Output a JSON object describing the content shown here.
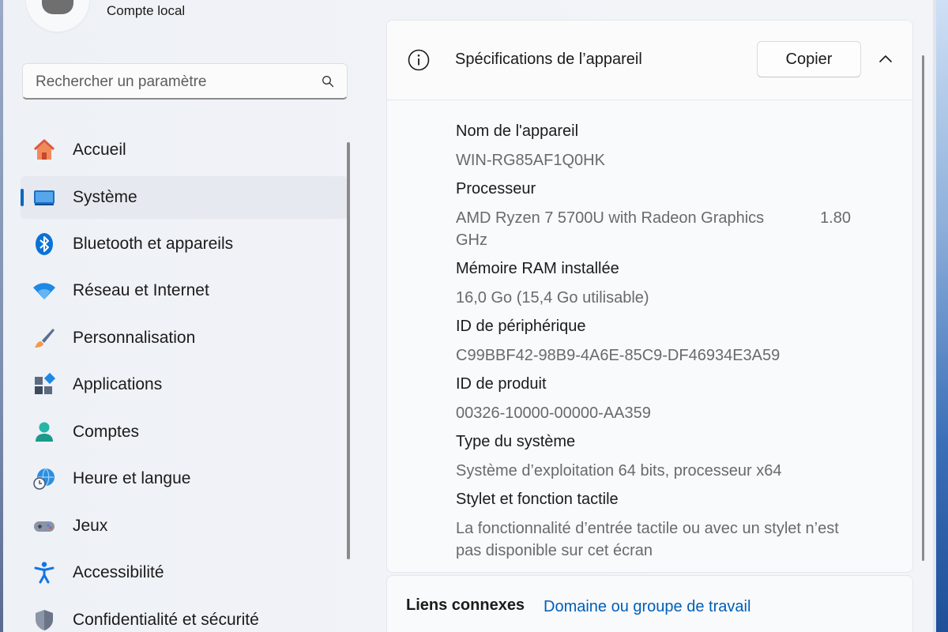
{
  "account": {
    "type": "Compte local"
  },
  "search": {
    "placeholder": "Rechercher un paramètre"
  },
  "sidebar": {
    "items": [
      {
        "label": "Accueil",
        "icon": "home-icon"
      },
      {
        "label": "Système",
        "icon": "system-icon",
        "active": true
      },
      {
        "label": "Bluetooth et appareils",
        "icon": "bluetooth-icon"
      },
      {
        "label": "Réseau et Internet",
        "icon": "wifi-icon"
      },
      {
        "label": "Personnalisation",
        "icon": "brush-icon"
      },
      {
        "label": "Applications",
        "icon": "apps-icon"
      },
      {
        "label": "Comptes",
        "icon": "account-icon"
      },
      {
        "label": "Heure et langue",
        "icon": "time-language-icon"
      },
      {
        "label": "Jeux",
        "icon": "gamepad-icon"
      },
      {
        "label": "Accessibilité",
        "icon": "accessibility-icon"
      },
      {
        "label": "Confidentialité et sécurité",
        "icon": "shield-icon"
      }
    ]
  },
  "specs_card": {
    "title": "Spécifications de l’appareil",
    "copy_label": "Copier",
    "rows": [
      {
        "label": "Nom de l'appareil",
        "value": "WIN-RG85AF1Q0HK"
      },
      {
        "label": "Processeur",
        "value": "AMD Ryzen 7 5700U with Radeon Graphics",
        "value_extra": "1.80",
        "value_line2": "GHz"
      },
      {
        "label": "Mémoire RAM installée",
        "value": "16,0 Go (15,4 Go utilisable)"
      },
      {
        "label": "ID de périphérique",
        "value": "C99BBF42-98B9-4A6E-85C9-DF46934E3A59"
      },
      {
        "label": "ID de produit",
        "value": "00326-10000-00000-AA359"
      },
      {
        "label": "Type du système",
        "value": "Système d’exploitation 64 bits, processeur x64"
      },
      {
        "label": "Stylet et fonction tactile",
        "value": "La fonctionnalité d’entrée tactile ou avec un stylet n’est pas disponible sur cet écran"
      }
    ]
  },
  "related": {
    "label": "Liens connexes",
    "link": "Domaine ou groupe de travail"
  },
  "colors": {
    "accent": "#0067c0",
    "link": "#005fb8"
  }
}
